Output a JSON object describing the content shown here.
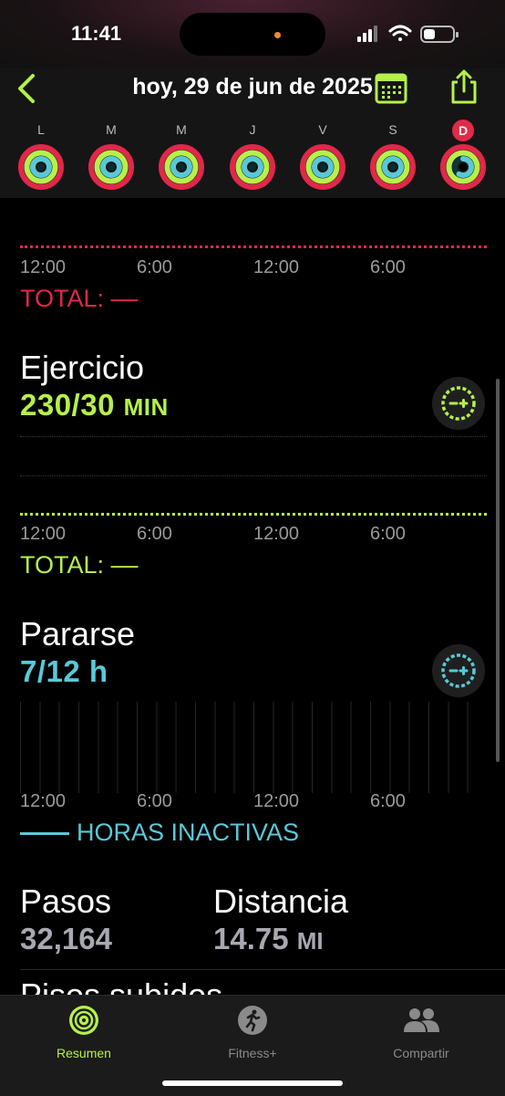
{
  "status": {
    "time": "11:41"
  },
  "header": {
    "date_title": "hoy, 29 de jun de 2025"
  },
  "days": [
    {
      "letter": "L"
    },
    {
      "letter": "M"
    },
    {
      "letter": "M"
    },
    {
      "letter": "J"
    },
    {
      "letter": "V"
    },
    {
      "letter": "S"
    },
    {
      "letter": "D",
      "selected": true
    }
  ],
  "move": {
    "axis": [
      "12:00",
      "6:00",
      "12:00",
      "6:00"
    ],
    "total": "TOTAL: ––"
  },
  "exercise": {
    "title": "Ejercicio",
    "value": "230/30",
    "unit": "MIN",
    "axis": [
      "12:00",
      "6:00",
      "12:00",
      "6:00"
    ],
    "total": "TOTAL: ––"
  },
  "stand": {
    "title": "Pararse",
    "value": "7/12 h",
    "axis": [
      "12:00",
      "6:00",
      "12:00",
      "6:00"
    ],
    "legend": "HORAS INACTIVAS"
  },
  "steps": {
    "label": "Pasos",
    "value": "32,164"
  },
  "distance": {
    "label": "Distancia",
    "value": "14.75",
    "unit": "MI"
  },
  "next_section": {
    "label": "Pisos subidos"
  },
  "tabs": [
    {
      "label": "Resumen",
      "icon": "rings-icon",
      "active": true
    },
    {
      "label": "Fitness+",
      "icon": "runner-icon"
    },
    {
      "label": "Compartir",
      "icon": "people-icon"
    }
  ],
  "colors": {
    "move": "#e0284a",
    "exercise": "#b6f04a",
    "stand": "#5ac8d8",
    "accent": "#b6f04a"
  }
}
